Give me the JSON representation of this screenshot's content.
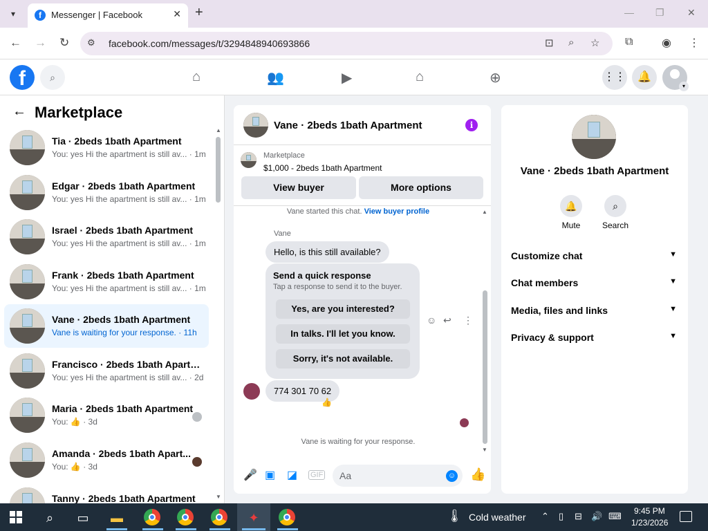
{
  "browser": {
    "tab_title": "Messenger | Facebook",
    "favicon": "f",
    "url": "facebook.com/messages/t/3294848940693866"
  },
  "fb": {
    "logo": "f"
  },
  "sidebar": {
    "title": "Marketplace",
    "conversations": [
      {
        "name": "Tia · 2beds 1bath Apartment",
        "preview": "You: yes Hi the apartment is still av... · 1m"
      },
      {
        "name": "Edgar · 2beds 1bath Apartment",
        "preview": "You: yes Hi the apartment is still av... · 1m"
      },
      {
        "name": "Israel · 2beds 1bath Apartment",
        "preview": "You: yes Hi the apartment is still av... · 1m"
      },
      {
        "name": "Frank · 2beds 1bath Apartment",
        "preview": "You: yes Hi the apartment is still av... · 1m"
      },
      {
        "name": "Vane · 2beds 1bath Apartment",
        "preview": "Vane is waiting for your response. · 11h"
      },
      {
        "name": "Francisco · 2beds 1bath Apartm...",
        "preview": "You: yes Hi the apartment is still av... · 2d"
      },
      {
        "name": "Maria · 2beds 1bath Apartment",
        "preview": "You: 👍 · 3d"
      },
      {
        "name": "Amanda · 2beds 1bath Apart...",
        "preview": "You: 👍 · 3d"
      },
      {
        "name": "Tanny · 2beds 1bath Apartment",
        "preview": ""
      }
    ]
  },
  "chat": {
    "title": "Vane · 2beds 1bath Apartment",
    "listing_category": "Marketplace",
    "listing_price": "$1,000 - 2beds 1bath Apartment",
    "view_buyer": "View buyer",
    "more_options": "More options",
    "started_text": "Vane started this chat.",
    "view_profile": "View buyer profile",
    "sender": "Vane",
    "message1": "Hello, is this still available?",
    "quick_title": "Send a quick response",
    "quick_subtitle": "Tap a response to send it to the buyer.",
    "quick_options": [
      "Yes, are you interested?",
      "In talks. I'll let you know.",
      "Sorry, it's not available."
    ],
    "message2": "774 301 70 62",
    "reaction": "👍",
    "waiting": "Vane is waiting for your response.",
    "placeholder": "Aa",
    "info_glyph": "i",
    "emoji_glyph": "☺"
  },
  "info": {
    "name": "Vane · 2beds 1bath Apartment",
    "mute": "Mute",
    "search": "Search",
    "rows": [
      "Customize chat",
      "Chat members",
      "Media, files and links",
      "Privacy & support"
    ]
  },
  "taskbar": {
    "weather": "Cold weather",
    "time": "9:45 PM",
    "date": "1/23/2026"
  },
  "colors": {
    "fb_blue": "#1877f2",
    "messenger_blue": "#0084ff",
    "active_row": "#ebf5ff",
    "info_purple": "#a020f0"
  }
}
